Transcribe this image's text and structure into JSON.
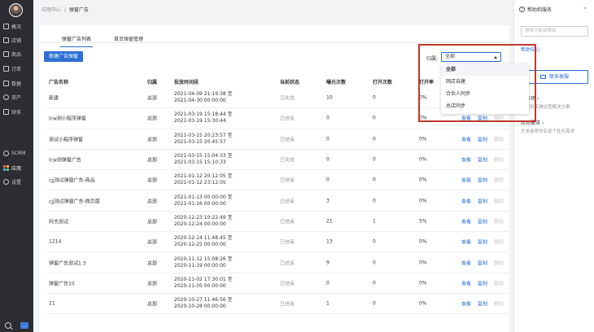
{
  "sidebar": {
    "items": [
      {
        "label": "概况",
        "icon": "home-icon"
      },
      {
        "label": "店铺",
        "icon": "store-icon"
      },
      {
        "label": "商品",
        "icon": "goods-icon"
      },
      {
        "label": "订单",
        "icon": "order-icon"
      },
      {
        "label": "数据",
        "icon": "chart-icon"
      },
      {
        "label": "资产",
        "icon": "asset-icon"
      },
      {
        "label": "财务",
        "icon": "finance-icon"
      }
    ],
    "bottom_items": [
      {
        "label": "SCRM",
        "icon": "scrm-icon"
      },
      {
        "label": "应用",
        "icon": "apps-icon"
      },
      {
        "label": "设置",
        "icon": "settings-icon"
      }
    ],
    "chat_badge": "..."
  },
  "breadcrumb": {
    "parent": "应用中心",
    "separator": "/",
    "current": "弹窗广告"
  },
  "tabs": [
    {
      "label": "弹窗广告列表",
      "active": true
    },
    {
      "label": "首页弹窗管理",
      "active": false
    }
  ],
  "toolbar": {
    "new_button": "新建广告弹窗",
    "filter_label": "归属:",
    "filter_value": "全部"
  },
  "dropdown": {
    "options": [
      "全部",
      "网店自建",
      "合伙人同步",
      "总店同步"
    ],
    "selected": "全部"
  },
  "table": {
    "columns": [
      "广告名称",
      "归属",
      "投放时间段",
      "当前状态",
      "曝光次数",
      "打开次数",
      "打开率"
    ],
    "actions": {
      "view": "查看",
      "copy": "复制",
      "delete": "删除"
    },
    "rows": [
      {
        "name": "新建",
        "owner": "总部",
        "start": "2021-04-09 21:19:38 至",
        "end": "2021-04-30 00:00:00",
        "status": "已失效",
        "views": "10",
        "opens": "0",
        "rate": "0%"
      },
      {
        "name": "lcw测小程序弹窗",
        "owner": "总部",
        "start": "2021-03-19 15:18:44 至",
        "end": "2021-03-19 15:30:44",
        "status": "已结束",
        "views": "0",
        "opens": "0",
        "rate": "0%"
      },
      {
        "name": "测试小程序弹窗",
        "owner": "总部",
        "start": "2021-03-15 20:23:57 至",
        "end": "2021-03-15 20:45:57",
        "status": "已结束",
        "views": "0",
        "opens": "0",
        "rate": "0%"
      },
      {
        "name": "lcw测弹窗广告",
        "owner": "总部",
        "start": "2021-03-15 15:04:33 至",
        "end": "2021-03-15 15:10:33",
        "status": "已失效",
        "views": "0",
        "opens": "0",
        "rate": "0%"
      },
      {
        "name": "cjj测试弹窗广告-商品",
        "owner": "总部",
        "start": "2021-01-12 20:12:05 至",
        "end": "2021-01-12 23:12:05",
        "status": "已结束",
        "views": "0",
        "opens": "0",
        "rate": "0%"
      },
      {
        "name": "cjj测试弹窗广告-微页面",
        "owner": "总部",
        "start": "2021-01-13 00:00:00 至",
        "end": "2021-01-16 00:00:00",
        "status": "已结束",
        "views": "3",
        "opens": "0",
        "rate": "0%"
      },
      {
        "name": "阿杰测试",
        "owner": "总部",
        "start": "2020-12-23 10:22:49 至",
        "end": "2020-12-24 00:00:00",
        "status": "已结束",
        "views": "21",
        "opens": "1",
        "rate": "5%"
      },
      {
        "name": "1214",
        "owner": "总部",
        "start": "2020-12-14 11:48:45 至",
        "end": "2020-12-25 00:00:00",
        "status": "已结束",
        "views": "13",
        "opens": "0",
        "rate": "0%"
      },
      {
        "name": "弹窗广告测试1.3",
        "owner": "总部",
        "start": "2020-11-12 15:08:26 至",
        "end": "2020-11-19 00:00:00",
        "status": "已结束",
        "views": "9",
        "opens": "0",
        "rate": "0%"
      },
      {
        "name": "弹窗广告10",
        "owner": "总部",
        "start": "2020-11-02 17:30:01 至",
        "end": "2020-11-05 00:00:00",
        "status": "已结束",
        "views": "0",
        "opens": "0",
        "rate": "0%"
      },
      {
        "name": "21",
        "owner": "总部",
        "start": "2020-10-27 11:46:56 至",
        "end": "2020-10-28 00:00:00",
        "status": "已结束",
        "views": "1",
        "opens": "0",
        "rate": "0%"
      }
    ]
  },
  "right_panel": {
    "title": "帮助和服务",
    "collapse_icon": "double-chevron-right-icon",
    "search_placeholder": "搜索功能或帮助",
    "help_center": "帮助中心",
    "contact_button": "联系客服",
    "links": [
      {
        "title": "务市场 ›",
        "desc": "你提供店铺运营解决方案"
      },
      {
        "title": "应用需求 ›",
        "desc": "开发者帮你实现个性化需求"
      }
    ]
  }
}
